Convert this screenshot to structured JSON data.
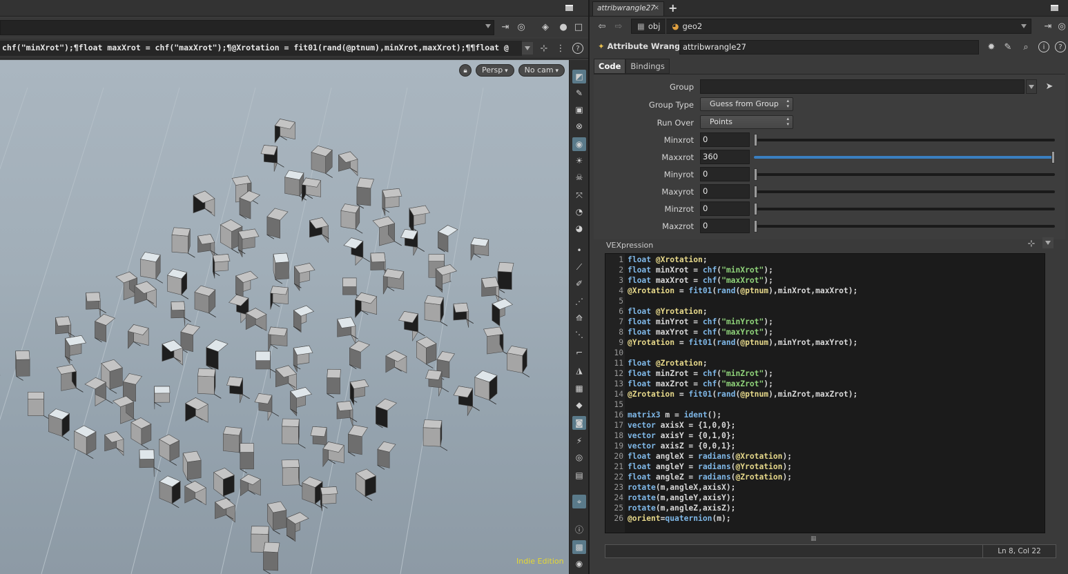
{
  "left_pane": {
    "command_line": "chf(\"minXrot\");¶float maxXrot = chf(\"maxXrot\");¶@Xrotation = fit01(rand(@ptnum),minXrot,maxXrot);¶¶float @",
    "viewport": {
      "camera_view": "Persp",
      "camera": "No cam",
      "edition_label": "Indie Edition"
    }
  },
  "right_pane": {
    "tab": {
      "label": "attribwrangle27",
      "close": "×",
      "add": "+"
    },
    "path": {
      "obj": "obj",
      "geo": "geo2"
    },
    "node": {
      "type_label": "Attribute Wrangle",
      "name": "attribwrangle27"
    },
    "tabs": [
      {
        "label": "Code"
      },
      {
        "label": "Bindings"
      }
    ],
    "params": {
      "group_label": "Group",
      "group_value": "",
      "group_type_label": "Group Type",
      "group_type_value": "Guess from Group",
      "run_over_label": "Run Over",
      "run_over_value": "Points",
      "sliders": [
        {
          "label": "Minxrot",
          "value": "0",
          "fraction": 0
        },
        {
          "label": "Maxxrot",
          "value": "360",
          "fraction": 1
        },
        {
          "label": "Minyrot",
          "value": "0",
          "fraction": 0
        },
        {
          "label": "Maxyrot",
          "value": "0",
          "fraction": 0
        },
        {
          "label": "Minzrot",
          "value": "0",
          "fraction": 0
        },
        {
          "label": "Maxzrot",
          "value": "0",
          "fraction": 0
        }
      ]
    },
    "vex_label": "VEXpression",
    "code_lines": [
      "float @Xrotation;",
      "float minXrot = chf(\"minXrot\");",
      "float maxXrot = chf(\"maxXrot\");",
      "@Xrotation = fit01(rand(@ptnum),minXrot,maxXrot);",
      "",
      "float @Yrotation;",
      "float minYrot = chf(\"minYrot\");",
      "float maxYrot = chf(\"maxYrot\");",
      "@Yrotation = fit01(rand(@ptnum),minYrot,maxYrot);",
      "",
      "float @Zrotation;",
      "float minZrot = chf(\"minZrot\");",
      "float maxZrot = chf(\"maxZrot\");",
      "@Zrotation = fit01(rand(@ptnum),minZrot,maxZrot);",
      "",
      "matrix3 m = ident();",
      "vector axisX = {1,0,0};",
      "vector axisY = {0,1,0};",
      "vector axisZ = {0,0,1};",
      "float angleX = radians(@Xrotation);",
      "float angleY = radians(@Yrotation);",
      "float angleZ = radians(@Zrotation);",
      "rotate(m,angleX,axisX);",
      "rotate(m,angleY,axisY);",
      "rotate(m,angleZ,axisZ);",
      "@orient=quaternion(m);"
    ],
    "cursor_position": "Ln 8, Col 22"
  }
}
